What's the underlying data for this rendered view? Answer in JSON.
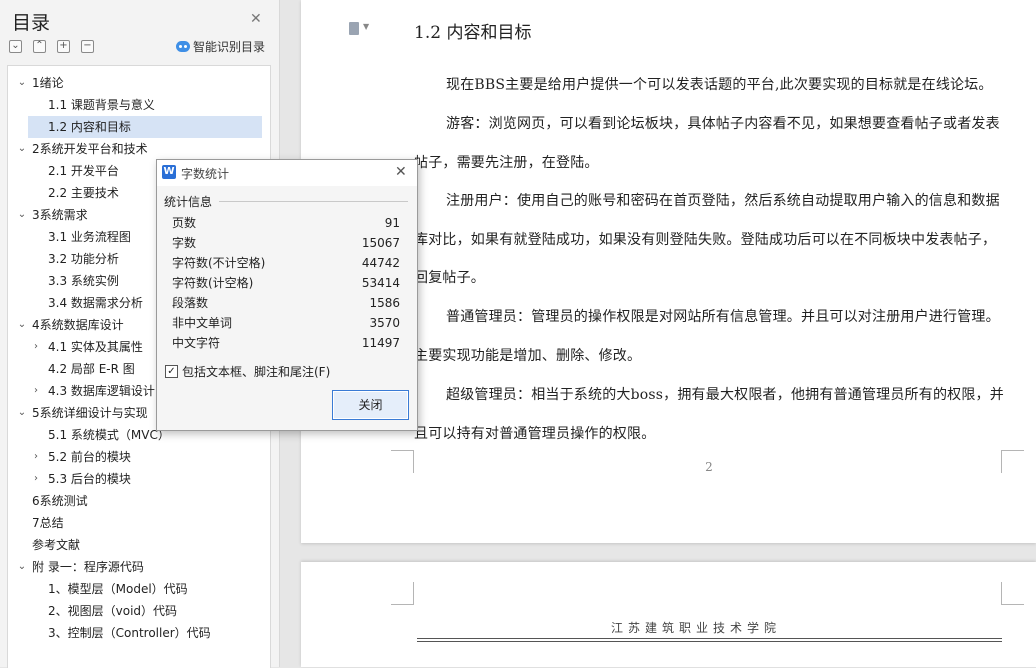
{
  "toc": {
    "title": "目录",
    "smart_label": "智能识别目录",
    "toolbar": [
      "⌄",
      "⌃",
      "+",
      "−"
    ],
    "items": [
      {
        "arrow": "⌄",
        "text": "1绪论"
      },
      {
        "arrow": "",
        "text": "1.1    课题背景与意义"
      },
      {
        "arrow": "",
        "text": "1.2    内容和目标"
      },
      {
        "arrow": "⌄",
        "text": "2系统开发平台和技术"
      },
      {
        "arrow": "",
        "text": "2.1    开发平台"
      },
      {
        "arrow": "",
        "text": "2.2    主要技术"
      },
      {
        "arrow": "⌄",
        "text": "3系统需求"
      },
      {
        "arrow": "",
        "text": "3.1    业务流程图"
      },
      {
        "arrow": "",
        "text": "3.2    功能分析"
      },
      {
        "arrow": "",
        "text": "3.3    系统实例"
      },
      {
        "arrow": "",
        "text": "3.4    数据需求分析"
      },
      {
        "arrow": "⌄",
        "text": "4系统数据库设计"
      },
      {
        "arrow": "›",
        "text": "4.1    实体及其属性"
      },
      {
        "arrow": "",
        "text": "4.2    局部 E-R 图"
      },
      {
        "arrow": "›",
        "text": "4.3    数据库逻辑设计"
      },
      {
        "arrow": "⌄",
        "text": "5系统详细设计与实现"
      },
      {
        "arrow": "",
        "text": "5.1    系统模式（MVC）"
      },
      {
        "arrow": "›",
        "text": "5.2    前台的模块"
      },
      {
        "arrow": "›",
        "text": "5.3    后台的模块"
      },
      {
        "arrow": "",
        "text": "6系统测试"
      },
      {
        "arrow": "",
        "text": "7总结"
      },
      {
        "arrow": "",
        "text": "参考文献"
      },
      {
        "arrow": "⌄",
        "text": "附    录一：程序源代码"
      },
      {
        "arrow": "",
        "text": "1、模型层（Model）代码"
      },
      {
        "arrow": "",
        "text": "2、视图层（void）代码"
      },
      {
        "arrow": "",
        "text": "3、控制层（Controller）代码"
      }
    ]
  },
  "document": {
    "heading": "1.2   内容和目标",
    "paragraphs": [
      "现在BBS主要是给用户提供一个可以发表话题的平台,此次要实现的目标就是在线论坛。",
      "游客：浏览网页，可以看到论坛板块，具体帖子内容看不见，如果想要查看帖子或者发表帖子，需要先注册，在登陆。",
      "注册用户：使用自己的账号和密码在首页登陆，然后系统自动提取用户输入的信息和数据库对比，如果有就登陆成功，如果没有则登陆失败。登陆成功后可以在不同板块中发表帖子，回复帖子。",
      "普通管理员：管理员的操作权限是对网站所有信息管理。并且可以对注册用户进行管理。主要实现功能是增加、删除、修改。",
      "超级管理员：相当于系统的大boss，拥有最大权限者，他拥有普通管理员所有的权限，并且可以持有对普通管理员操作的权限。"
    ],
    "page_number": "2",
    "next_page_header": "江苏建筑职业技术学院"
  },
  "dialog": {
    "logo": "W",
    "title": "字数统计",
    "section": "统计信息",
    "stats": [
      {
        "label": "页数",
        "value": "91"
      },
      {
        "label": "字数",
        "value": "15067"
      },
      {
        "label": "字符数(不计空格)",
        "value": "44742"
      },
      {
        "label": "字符数(计空格)",
        "value": "53414"
      },
      {
        "label": "段落数",
        "value": "1586"
      },
      {
        "label": "非中文单词",
        "value": "3570"
      },
      {
        "label": "中文字符",
        "value": "11497"
      }
    ],
    "checkbox_label": "包括文本框、脚注和尾注(F)",
    "checkbox_checked": true,
    "close_button": "关闭"
  },
  "colors": {
    "selected_row": "#d6e3f5",
    "accent": "#2a6fd6"
  }
}
